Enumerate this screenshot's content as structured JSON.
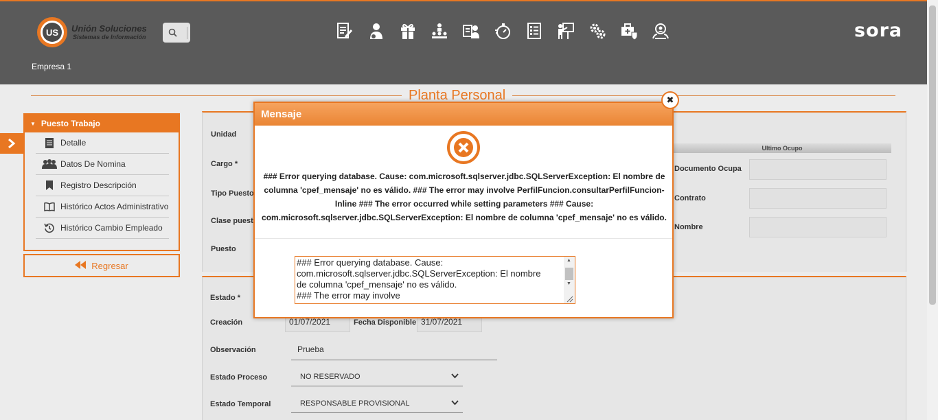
{
  "header": {
    "logo_title": "Unión Soluciones",
    "logo_subtitle": "Sistemas de Información",
    "logo_badge": "US",
    "brand": "sora",
    "company": "Empresa 1",
    "nav_icons": [
      "document-edit-icon",
      "person-tie-icon",
      "gift-icon",
      "org-chart-icon",
      "id-card-person-icon",
      "stopwatch-icon",
      "checklist-icon",
      "presentation-icon",
      "gears-icon",
      "medical-bag-icon",
      "search-people-icon"
    ]
  },
  "page": {
    "title": "Planta Personal"
  },
  "sidebar": {
    "title": "Puesto Trabajo",
    "items": [
      {
        "label": "Detalle",
        "icon": "document-icon"
      },
      {
        "label": "Datos De Nomina",
        "icon": "users-icon"
      },
      {
        "label": "Registro Descripción",
        "icon": "bookmark-icon"
      },
      {
        "label": "Histórico Actos Administrativo",
        "icon": "book-icon"
      },
      {
        "label": "Histórico Cambio Empleado",
        "icon": "history-icon"
      }
    ],
    "back_label": "Regresar"
  },
  "form": {
    "unidad_label": "Unidad",
    "cargo_label": "Cargo *",
    "tipo_puesto_label": "Tipo Puesto",
    "clase_puesto_label": "Clase puest",
    "puesto_label": "Puesto",
    "ultimo_ocupo": "Ultimo Ocupo",
    "documento_ocupa_label": "Documento Ocupa",
    "contrato_label": "Contrato",
    "nombre_label": "Nombre",
    "estado_label": "Estado *",
    "creacion_label": "Creación",
    "creacion_value": "01/07/2021",
    "fecha_disponible_label": "Fecha Disponible",
    "fecha_disponible_value": "31/07/2021",
    "observacion_label": "Observación",
    "observacion_value": "Prueba",
    "estado_proceso_label": "Estado Proceso",
    "estado_proceso_value": "NO RESERVADO",
    "estado_temporal_label": "Estado Temporal",
    "estado_temporal_value": "RESPONSABLE PROVISIONAL"
  },
  "modal": {
    "title": "Mensaje",
    "message": "### Error querying database. Cause: com.microsoft.sqlserver.jdbc.SQLServerException: El nombre de columna 'cpef_mensaje' no es válido. ### The error may involve PerfilFuncion.consultarPerfilFuncion-Inline ### The error occurred while setting parameters ### Cause: com.microsoft.sqlserver.jdbc.SQLServerException: El nombre de columna 'cpef_mensaje' no es válido.",
    "textarea_lines": [
      "### Error querying database.  Cause:",
      "com.microsoft.sqlserver.jdbc.SQLServerException: El nombre",
      "de columna 'cpef_mensaje' no es válido.",
      "### The error may involve"
    ],
    "close_symbol": "✖"
  },
  "colors": {
    "accent": "#e87722",
    "header_bg": "#5a5a5a",
    "page_bg": "#ececec"
  }
}
